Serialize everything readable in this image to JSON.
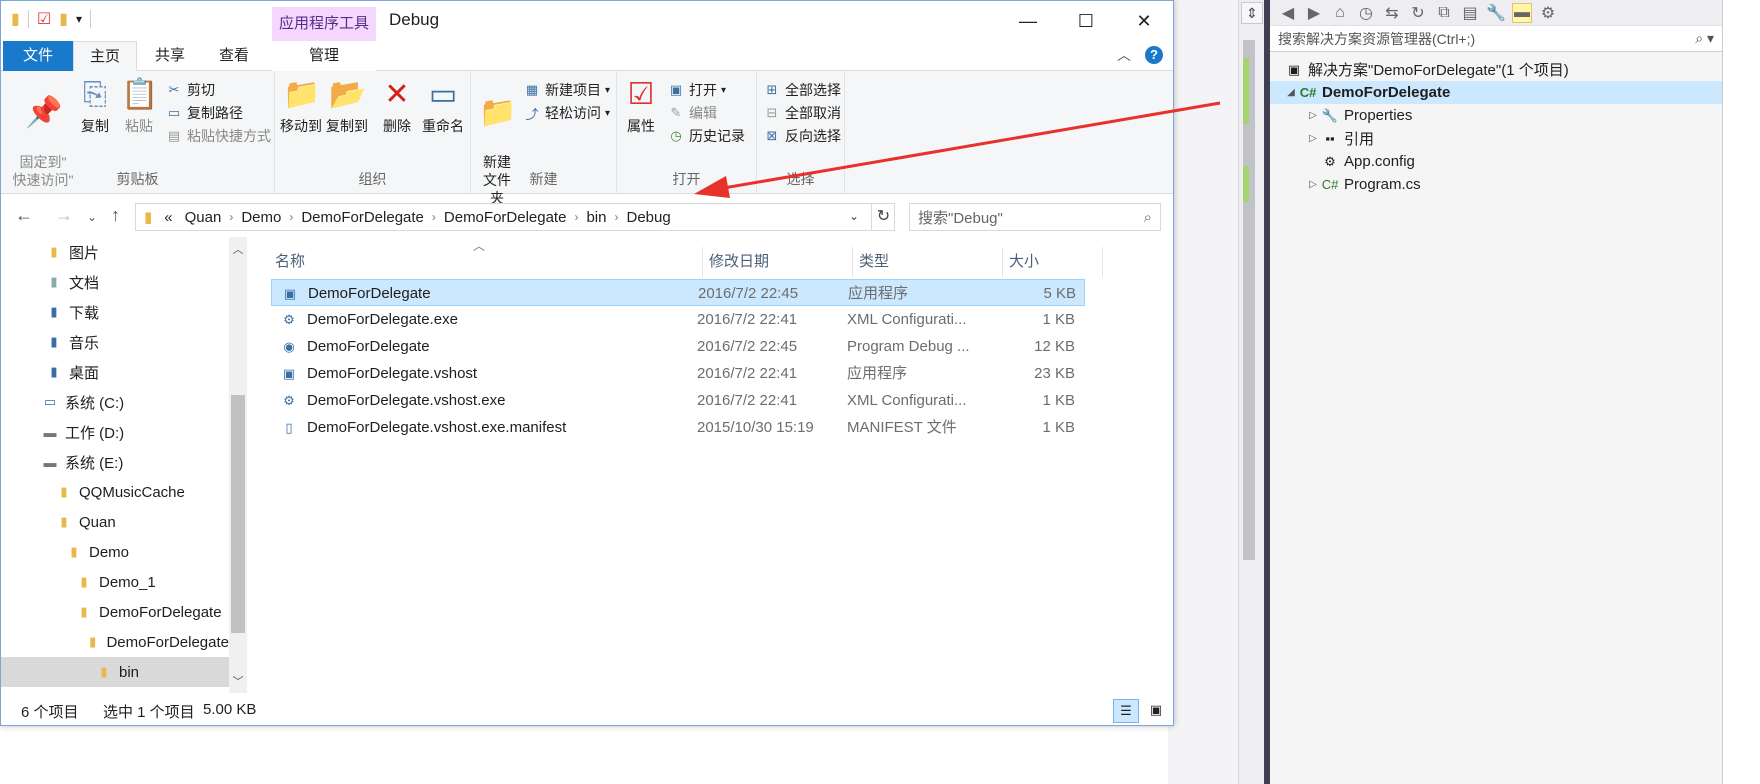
{
  "window": {
    "title": "Debug",
    "context_tool": "应用程序工具",
    "caption": {
      "minimize": "—",
      "maximize": "☐",
      "close": "✕"
    }
  },
  "tabs": {
    "file": "文件",
    "home": "主页",
    "share": "共享",
    "view": "查看",
    "manage": "管理"
  },
  "ribbon": {
    "clipboard": {
      "label": "剪贴板",
      "pin": "固定到\"\n快速访问\"",
      "copy": "复制",
      "paste": "粘贴",
      "cut": "剪切",
      "copy_path": "复制路径",
      "paste_shortcut": "粘贴快捷方式"
    },
    "organize": {
      "label": "组织",
      "move_to": "移动到",
      "copy_to": "复制到",
      "delete": "删除",
      "rename": "重命名"
    },
    "new": {
      "label": "新建",
      "new_folder": "新建\n文件夹",
      "new_item": "新建项目",
      "easy_access": "轻松访问"
    },
    "open": {
      "label": "打开",
      "properties": "属性",
      "open": "打开",
      "edit": "编辑",
      "history": "历史记录"
    },
    "select": {
      "label": "选择",
      "select_all": "全部选择",
      "select_none": "全部取消",
      "invert": "反向选择"
    }
  },
  "address": {
    "overflow": "«",
    "crumbs": [
      "Quan",
      "Demo",
      "DemoForDelegate",
      "DemoForDelegate",
      "bin",
      "Debug"
    ],
    "search_placeholder": "搜索\"Debug\""
  },
  "nav_tree": [
    {
      "label": "图片",
      "icon": "pictures-folder-icon"
    },
    {
      "label": "文档",
      "icon": "documents-folder-icon"
    },
    {
      "label": "下载",
      "icon": "downloads-folder-icon"
    },
    {
      "label": "音乐",
      "icon": "music-folder-icon"
    },
    {
      "label": "桌面",
      "icon": "desktop-folder-icon"
    },
    {
      "label": "系统 (C:)",
      "icon": "system-drive-icon"
    },
    {
      "label": "工作 (D:)",
      "icon": "drive-icon"
    },
    {
      "label": "系统 (E:)",
      "icon": "drive-icon"
    },
    {
      "label": "QQMusicCache",
      "icon": "folder-icon"
    },
    {
      "label": "Quan",
      "icon": "folder-icon"
    },
    {
      "label": "Demo",
      "icon": "folder-icon"
    },
    {
      "label": "Demo_1",
      "icon": "folder-icon"
    },
    {
      "label": "DemoForDelegate",
      "icon": "folder-icon"
    },
    {
      "label": "DemoForDelegate",
      "icon": "folder-icon"
    },
    {
      "label": "bin",
      "icon": "folder-icon"
    }
  ],
  "columns": {
    "name": "名称",
    "date": "修改日期",
    "type": "类型",
    "size": "大小"
  },
  "files": [
    {
      "name": "DemoForDelegate",
      "date": "2016/7/2 22:45",
      "type": "应用程序",
      "size": "5 KB",
      "icon": "application-icon"
    },
    {
      "name": "DemoForDelegate.exe",
      "date": "2016/7/2 22:41",
      "type": "XML Configurati...",
      "size": "1 KB",
      "icon": "config-file-icon"
    },
    {
      "name": "DemoForDelegate",
      "date": "2016/7/2 22:45",
      "type": "Program Debug ...",
      "size": "12 KB",
      "icon": "pdb-file-icon"
    },
    {
      "name": "DemoForDelegate.vshost",
      "date": "2016/7/2 22:41",
      "type": "应用程序",
      "size": "23 KB",
      "icon": "application-icon"
    },
    {
      "name": "DemoForDelegate.vshost.exe",
      "date": "2016/7/2 22:41",
      "type": "XML Configurati...",
      "size": "1 KB",
      "icon": "config-file-icon"
    },
    {
      "name": "DemoForDelegate.vshost.exe.manifest",
      "date": "2015/10/30 15:19",
      "type": "MANIFEST 文件",
      "size": "1 KB",
      "icon": "file-icon"
    }
  ],
  "status": {
    "count": "6 个项目",
    "selected": "选中 1 个项目",
    "size": "5.00 KB"
  },
  "solution_explorer": {
    "search_placeholder": "搜索解决方案资源管理器(Ctrl+;)",
    "solution": "解决方案\"DemoForDelegate\"(1 个项目)",
    "project": "DemoForDelegate",
    "items": [
      "Properties",
      "引用",
      "App.config",
      "Program.cs"
    ]
  },
  "colors": {
    "accent": "#1979ca",
    "selection": "#cce8ff",
    "annotation": "#e8312a",
    "context_tab": "#f4d7ff"
  }
}
